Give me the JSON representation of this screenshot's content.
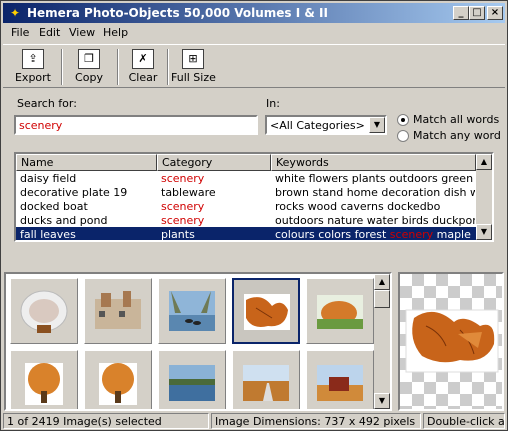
{
  "window": {
    "title": "Hemera Photo-Objects 50,000 Volumes I & II",
    "minimize": "_",
    "maximize": "□",
    "close": "×"
  },
  "menu": [
    "File",
    "Edit",
    "View",
    "Help"
  ],
  "toolbar": [
    {
      "label": "Export",
      "icon": "export-icon"
    },
    {
      "label": "Copy",
      "icon": "copy-icon"
    },
    {
      "label": "Clear",
      "icon": "clear-icon"
    },
    {
      "label": "Full Size",
      "icon": "full-size-icon"
    }
  ],
  "search": {
    "label": "Search for:",
    "value": "scenery"
  },
  "category": {
    "label": "In:",
    "selected": "<All Categories>"
  },
  "match": {
    "all_label": "Match all words",
    "any_label": "Match any word",
    "selected": "all"
  },
  "results": {
    "columns": [
      "Name",
      "Category",
      "Keywords"
    ],
    "rows": [
      {
        "name": "daisy field",
        "category": "scenery",
        "kw_pre": "white flowers plants outdoors green grass r",
        "kw_hit": "",
        "kw_post": ""
      },
      {
        "name": "decorative plate 19",
        "category": "tableware",
        "kw_pre": "brown stand home decoration dish white ho",
        "kw_hit": "",
        "kw_post": ""
      },
      {
        "name": "docked boat",
        "category": "scenery",
        "kw_pre": "rocks wood caverns dockedbo",
        "kw_hit": "",
        "kw_post": ""
      },
      {
        "name": "ducks and pond",
        "category": "scenery",
        "kw_pre": "outdoors nature water birds duckpond",
        "kw_hit": "",
        "kw_post": ""
      },
      {
        "name": "fall leaves",
        "category": "plants",
        "kw_pre": "colours colors forest ",
        "kw_hit": "scenery",
        "kw_post": " maple leaf ora"
      }
    ],
    "selected_index": 4
  },
  "gallery": {
    "selected_index": 3,
    "thumbs": [
      "plate",
      "town",
      "ducks",
      "leaves",
      "bush",
      "tree",
      "tree",
      "lake",
      "road",
      "barn"
    ]
  },
  "status": {
    "selection": "1 of 2419 Image(s) selected",
    "dimensions": "Image Dimensions: 737 x 492 pixels",
    "hint": "Double-click a"
  },
  "colors": {
    "title_start": "#0a246a",
    "title_end": "#a6caf0",
    "highlight": "#d00000",
    "selection": "#0a246a"
  }
}
